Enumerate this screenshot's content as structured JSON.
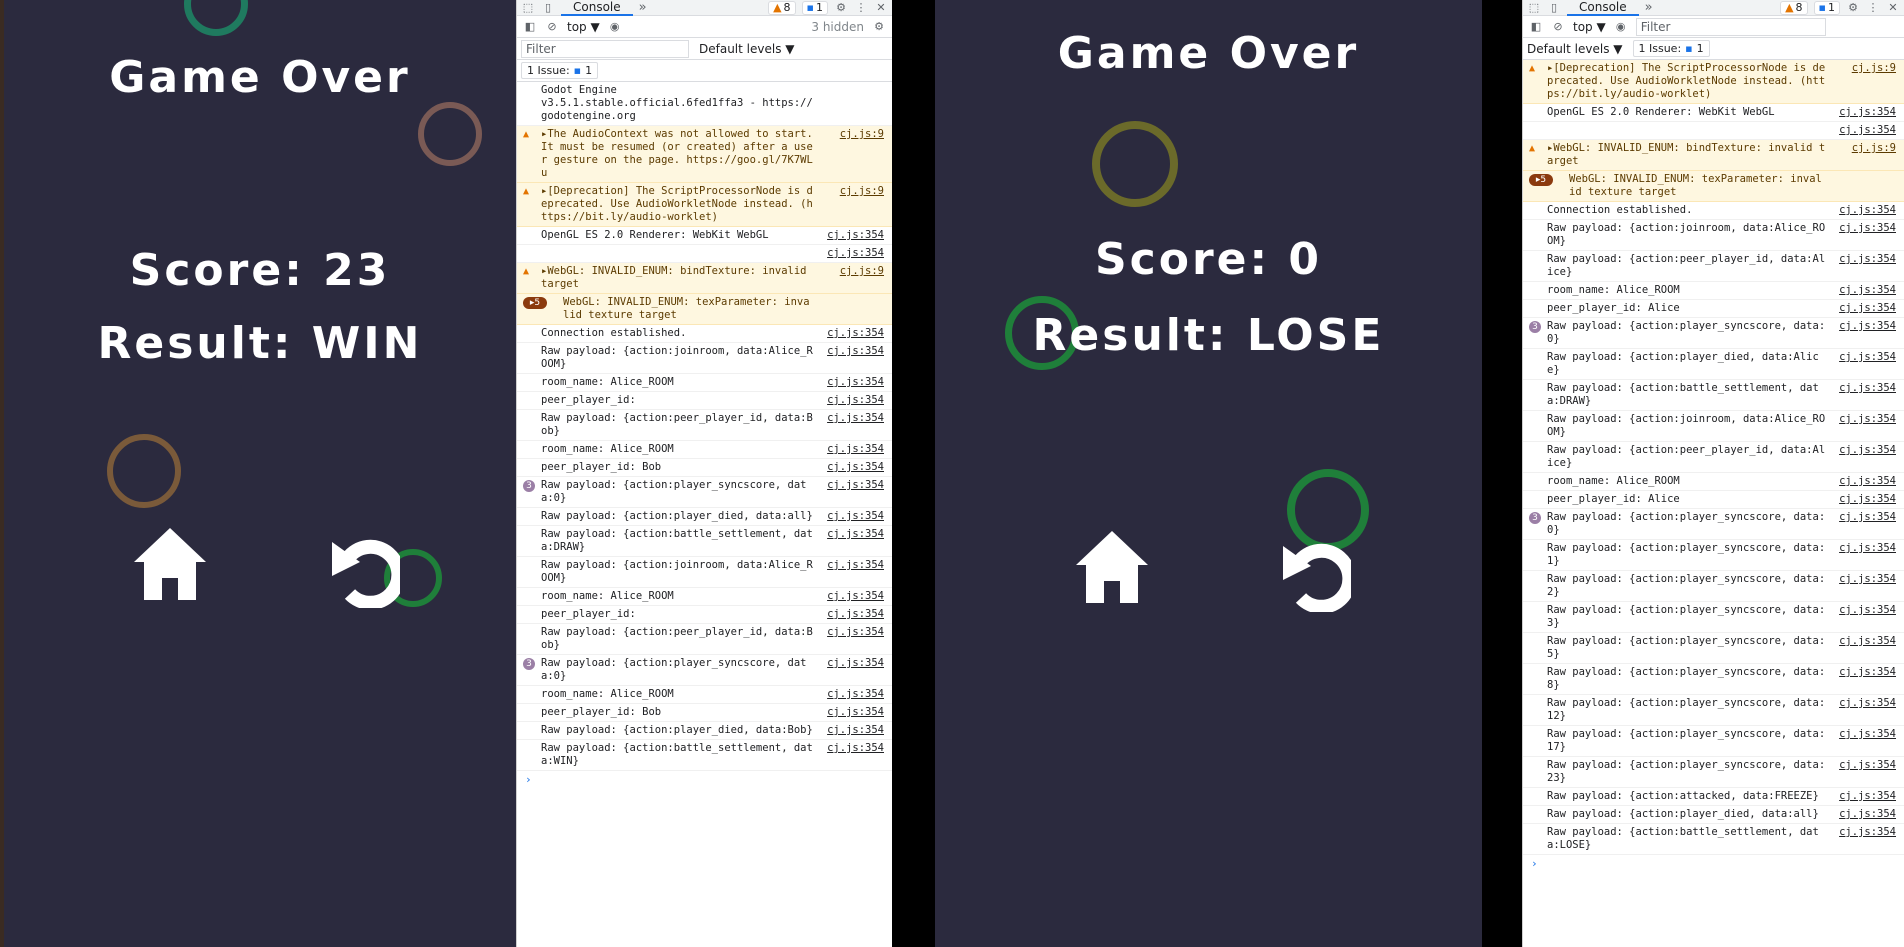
{
  "left_game": {
    "title": "Game Over",
    "score": "Score: 23",
    "result": "Result: WIN"
  },
  "right_game": {
    "title": "Game Over",
    "score": "Score: 0",
    "result": "Result: LOSE"
  },
  "buttons": {
    "home_icon": "home-icon",
    "restart_icon": "restart-icon"
  },
  "colors": {
    "game_bg": "#2b2a3e",
    "ring_teal": "#1f7a5f",
    "ring_rose": "#7a5a55",
    "ring_brown": "#7a5a3a",
    "ring_green": "#1f7f3a",
    "ring_olive": "#6b6a2a"
  },
  "devtools_left": {
    "tab": "Console",
    "warn_count": "8",
    "info_count": "1",
    "context": "top ▼",
    "hidden": "3 hidden",
    "filter_placeholder": "Filter",
    "levels": "Default levels ▼",
    "issue_label": "1 Issue:",
    "issue_count": "1",
    "messages": [
      {
        "text": "Godot Engine\nv3.5.1.stable.official.6fed1ffa3 - https://godotengine.org",
        "src": ""
      },
      {
        "text": "▸The AudioContext was not allowed to start. It must be resumed (or created) after a user gesture on the page. https://goo.gl/7K7WLu",
        "src": "cj.js:9"
      },
      {
        "text": "▸[Deprecation] The ScriptProcessorNode is deprecated. Use AudioWorkletNode instead. (https://bit.ly/audio-worklet)",
        "src": "cj.js:9"
      },
      {
        "text": "OpenGL ES 2.0 Renderer: WebKit WebGL",
        "src": "cj.js:354"
      },
      {
        "text": "",
        "src": "cj.js:354"
      },
      {
        "text": "▸WebGL: INVALID_ENUM: bindTexture: invalid target",
        "src": "cj.js:9"
      },
      {
        "count": "▸5",
        "text": "WebGL: INVALID_ENUM: texParameter: invalid texture target",
        "src": ""
      },
      {
        "text": "Connection established.",
        "src": "cj.js:354"
      },
      {
        "text": "Raw payload: {action:joinroom, data:Alice_ROOM}",
        "src": "cj.js:354"
      },
      {
        "text": "room_name: Alice_ROOM",
        "src": "cj.js:354"
      },
      {
        "text": "peer_player_id:",
        "src": "cj.js:354"
      },
      {
        "text": "Raw payload: {action:peer_player_id, data:Bob}",
        "src": "cj.js:354"
      },
      {
        "text": "room_name: Alice_ROOM",
        "src": "cj.js:354"
      },
      {
        "text": "peer_player_id: Bob",
        "src": "cj.js:354"
      },
      {
        "count": "3",
        "text": "Raw payload: {action:player_syncscore, data:0}",
        "src": "cj.js:354"
      },
      {
        "text": "Raw payload: {action:player_died, data:all}",
        "src": "cj.js:354"
      },
      {
        "text": "Raw payload: {action:battle_settlement, data:DRAW}",
        "src": "cj.js:354"
      },
      {
        "text": "Raw payload: {action:joinroom, data:Alice_ROOM}",
        "src": "cj.js:354"
      },
      {
        "text": "room_name: Alice_ROOM",
        "src": "cj.js:354"
      },
      {
        "text": "peer_player_id:",
        "src": "cj.js:354"
      },
      {
        "text": "Raw payload: {action:peer_player_id, data:Bob}",
        "src": "cj.js:354"
      },
      {
        "count": "3",
        "text": "Raw payload: {action:player_syncscore, data:0}",
        "src": "cj.js:354"
      },
      {
        "text": "room_name: Alice_ROOM",
        "src": "cj.js:354"
      },
      {
        "text": "peer_player_id: Bob",
        "src": "cj.js:354"
      },
      {
        "text": "Raw payload: {action:player_died, data:Bob}",
        "src": "cj.js:354"
      },
      {
        "text": "Raw payload: {action:battle_settlement, data:WIN}",
        "src": "cj.js:354"
      }
    ]
  },
  "devtools_right": {
    "tab": "Console",
    "warn_count": "8",
    "info_count": "1",
    "context": "top ▼",
    "filter_placeholder": "Filter",
    "levels": "Default levels ▼",
    "issue_label": "1 Issue:",
    "issue_count": "1",
    "messages": [
      {
        "text": "▸[Deprecation] The ScriptProcessorNode is deprecated. Use AudioWorkletNode instead. (https://bit.ly/audio-worklet)",
        "src": "cj.js:9"
      },
      {
        "text": "OpenGL ES 2.0 Renderer: WebKit WebGL",
        "src": "cj.js:354"
      },
      {
        "text": "",
        "src": "cj.js:354"
      },
      {
        "text": "▸WebGL: INVALID_ENUM: bindTexture: invalid target",
        "src": "cj.js:9"
      },
      {
        "count": "▸5",
        "text": "WebGL: INVALID_ENUM: texParameter: invalid texture target",
        "src": ""
      },
      {
        "text": "Connection established.",
        "src": "cj.js:354"
      },
      {
        "text": "Raw payload: {action:joinroom, data:Alice_ROOM}",
        "src": "cj.js:354"
      },
      {
        "text": "Raw payload: {action:peer_player_id, data:Alice}",
        "src": "cj.js:354"
      },
      {
        "text": "room_name: Alice_ROOM",
        "src": "cj.js:354"
      },
      {
        "text": "peer_player_id: Alice",
        "src": "cj.js:354"
      },
      {
        "count": "3",
        "text": "Raw payload: {action:player_syncscore, data:0}",
        "src": "cj.js:354"
      },
      {
        "text": "Raw payload: {action:player_died, data:Alice}",
        "src": "cj.js:354"
      },
      {
        "text": "Raw payload: {action:battle_settlement, data:DRAW}",
        "src": "cj.js:354"
      },
      {
        "text": "Raw payload: {action:joinroom, data:Alice_ROOM}",
        "src": "cj.js:354"
      },
      {
        "text": "Raw payload: {action:peer_player_id, data:Alice}",
        "src": "cj.js:354"
      },
      {
        "text": "room_name: Alice_ROOM",
        "src": "cj.js:354"
      },
      {
        "text": "peer_player_id: Alice",
        "src": "cj.js:354"
      },
      {
        "count": "3",
        "text": "Raw payload: {action:player_syncscore, data:0}",
        "src": "cj.js:354"
      },
      {
        "text": "Raw payload: {action:player_syncscore, data:1}",
        "src": "cj.js:354"
      },
      {
        "text": "Raw payload: {action:player_syncscore, data:2}",
        "src": "cj.js:354"
      },
      {
        "text": "Raw payload: {action:player_syncscore, data:3}",
        "src": "cj.js:354"
      },
      {
        "text": "Raw payload: {action:player_syncscore, data:5}",
        "src": "cj.js:354"
      },
      {
        "text": "Raw payload: {action:player_syncscore, data:8}",
        "src": "cj.js:354"
      },
      {
        "text": "Raw payload: {action:player_syncscore, data:12}",
        "src": "cj.js:354"
      },
      {
        "text": "Raw payload: {action:player_syncscore, data:17}",
        "src": "cj.js:354"
      },
      {
        "text": "Raw payload: {action:player_syncscore, data:23}",
        "src": "cj.js:354"
      },
      {
        "text": "Raw payload: {action:attacked, data:FREEZE}",
        "src": "cj.js:354"
      },
      {
        "text": "Raw payload: {action:player_died, data:all}",
        "src": "cj.js:354"
      },
      {
        "text": "Raw payload: {action:battle_settlement, data:LOSE}",
        "src": "cj.js:354"
      }
    ]
  }
}
